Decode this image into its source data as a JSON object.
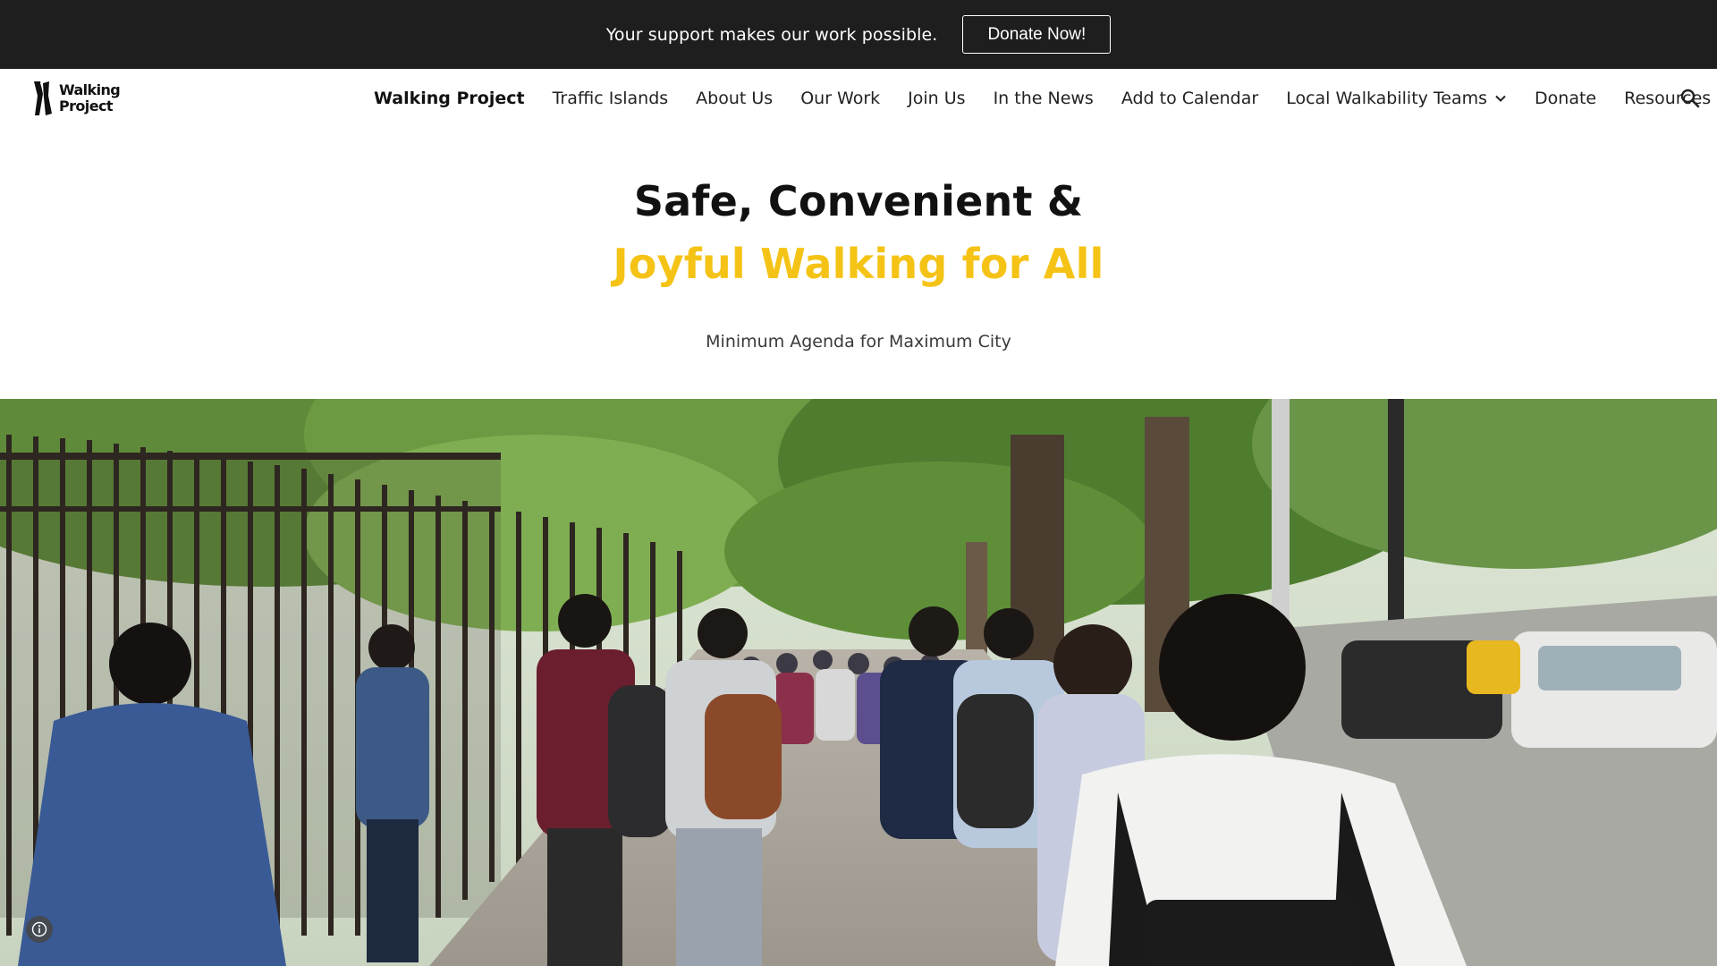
{
  "banner": {
    "message": "Your support makes our work possible.",
    "donate_button": "Donate Now!"
  },
  "logo": {
    "line1": "Walking",
    "line2": "Project"
  },
  "nav": {
    "items": [
      {
        "label": "Walking Project",
        "active": true
      },
      {
        "label": "Traffic Islands"
      },
      {
        "label": "About Us"
      },
      {
        "label": "Our Work"
      },
      {
        "label": "Join Us"
      },
      {
        "label": "In the News"
      },
      {
        "label": "Add to Calendar"
      },
      {
        "label": "Local Walkability Teams",
        "icon": "chevron-down-icon"
      },
      {
        "label": "Donate"
      },
      {
        "label": "Resources"
      }
    ],
    "search_icon": "search-icon"
  },
  "hero": {
    "title_line1": "Safe, Convenient &",
    "title_line2": "Joyful Walking for All",
    "subtitle": "Minimum Agenda for Maximum City",
    "photo_description_icon": "photo",
    "info_icon": "info-icon"
  },
  "colors": {
    "banner_bg": "#1e1e1e",
    "accent_yellow": "#f5c316",
    "text_dark": "#111111"
  }
}
